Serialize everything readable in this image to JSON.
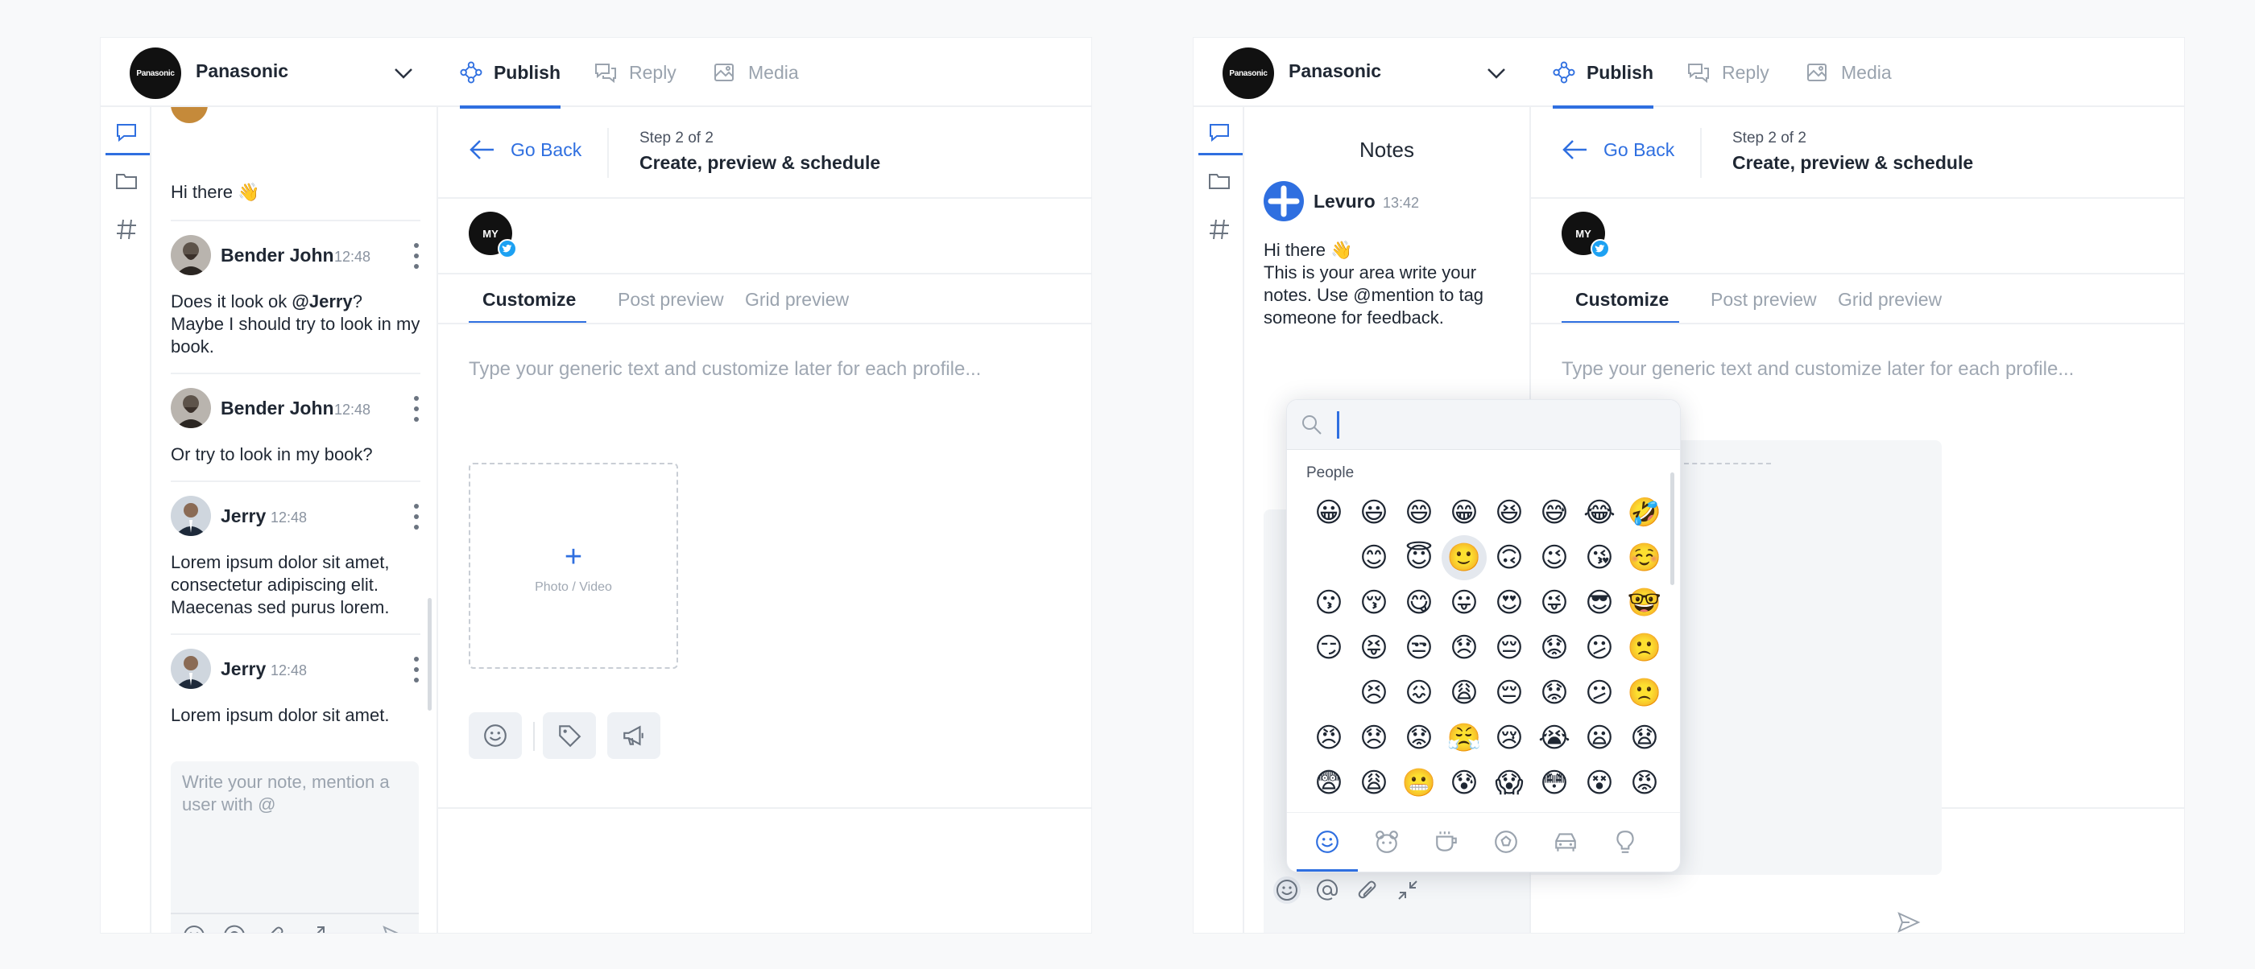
{
  "brand": {
    "logo_text": "Panasonic",
    "name": "Panasonic"
  },
  "nav": {
    "publish": "Publish",
    "reply": "Reply",
    "media": "Media"
  },
  "main": {
    "go_back": "Go Back",
    "step": "Step 2 of 2",
    "step_title": "Create, preview & schedule",
    "profile_label": "MY",
    "tabs": [
      "Customize",
      "Post preview",
      "Grid preview"
    ],
    "compose_placeholder": "Type your generic text and customize later for each profile...",
    "dropzone_label": "Photo / Video",
    "dropzone_plus": "+"
  },
  "notes": {
    "title": "Notes",
    "greeting": "Hi there 👋",
    "messages": [
      {
        "author": "Bender John",
        "time": "12:48",
        "text_pre": "Does it look ok ",
        "mention": "@Jerry",
        "text_post": "? Maybe I should try to look in my book."
      },
      {
        "author": "Bender John",
        "time": "12:48",
        "text": "Or try to look in my book?"
      },
      {
        "author": "Jerry",
        "time": "12:48",
        "text": "Lorem ipsum dolor sit amet, consectetur adipiscing elit. Maecenas sed purus lorem."
      },
      {
        "author": "Jerry",
        "time": "12:48",
        "text": "Lorem ipsum dolor sit amet."
      }
    ],
    "composer_placeholder": "Write your note, mention a user with @",
    "levuro": {
      "author": "Levuro",
      "time": "13:42",
      "greeting": "Hi there 👋",
      "text": "This is your area write your notes. Use @mention to tag someone for feedback."
    }
  },
  "emoji_picker": {
    "category": "People",
    "rows": [
      [
        "😀",
        "😃",
        "😄",
        "😁",
        "😆",
        "😅",
        "😂",
        "🤣"
      ],
      [
        "",
        "😊",
        "😇",
        "🙂",
        "🙃",
        "😉",
        "😘",
        "☺️"
      ],
      [
        "😗",
        "😚",
        "😋",
        "😛",
        "😍",
        "😜",
        "😎",
        "🤓"
      ],
      [
        "😏",
        "😝",
        "😒",
        "😞",
        "😔",
        "😟",
        "😕",
        "🙁"
      ],
      [
        "",
        "😣",
        "😖",
        "😩",
        "😔",
        "😟",
        "😕",
        "🙁"
      ],
      [
        "😠",
        "😞",
        "😟",
        "😤",
        "😢",
        "😭",
        "😦",
        "😧"
      ],
      [
        "😨",
        "😩",
        "😬",
        "😰",
        "😱",
        "😳",
        "😵",
        "😡"
      ]
    ],
    "selected": {
      "row": 1,
      "col": 3
    }
  },
  "colors": {
    "accent": "#2f6fe0",
    "twitter": "#1da1f2",
    "text": "#1f2733",
    "muted": "#9aa3ae"
  }
}
